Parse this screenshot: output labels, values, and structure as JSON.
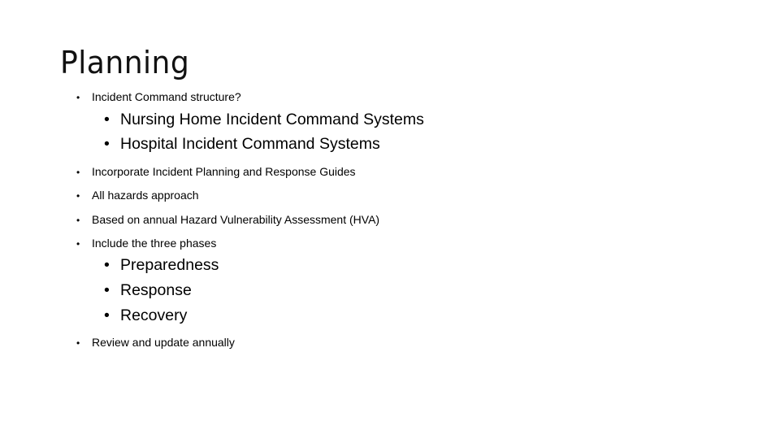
{
  "slide": {
    "title": "Planning",
    "bullet_glyph": "•",
    "items": [
      {
        "text": "Incident Command structure?"
      },
      {
        "text": "Nursing Home Incident Command Systems"
      },
      {
        "text": "Hospital Incident Command Systems"
      },
      {
        "text": "Incorporate Incident Planning and Response Guides"
      },
      {
        "text": "All hazards approach"
      },
      {
        "text": "Based on annual Hazard Vulnerability Assessment (HVA)"
      },
      {
        "text": "Include the three phases"
      },
      {
        "text": "Preparedness"
      },
      {
        "text": "Response"
      },
      {
        "text": "Recovery"
      },
      {
        "text": "Review and update annually"
      }
    ]
  }
}
